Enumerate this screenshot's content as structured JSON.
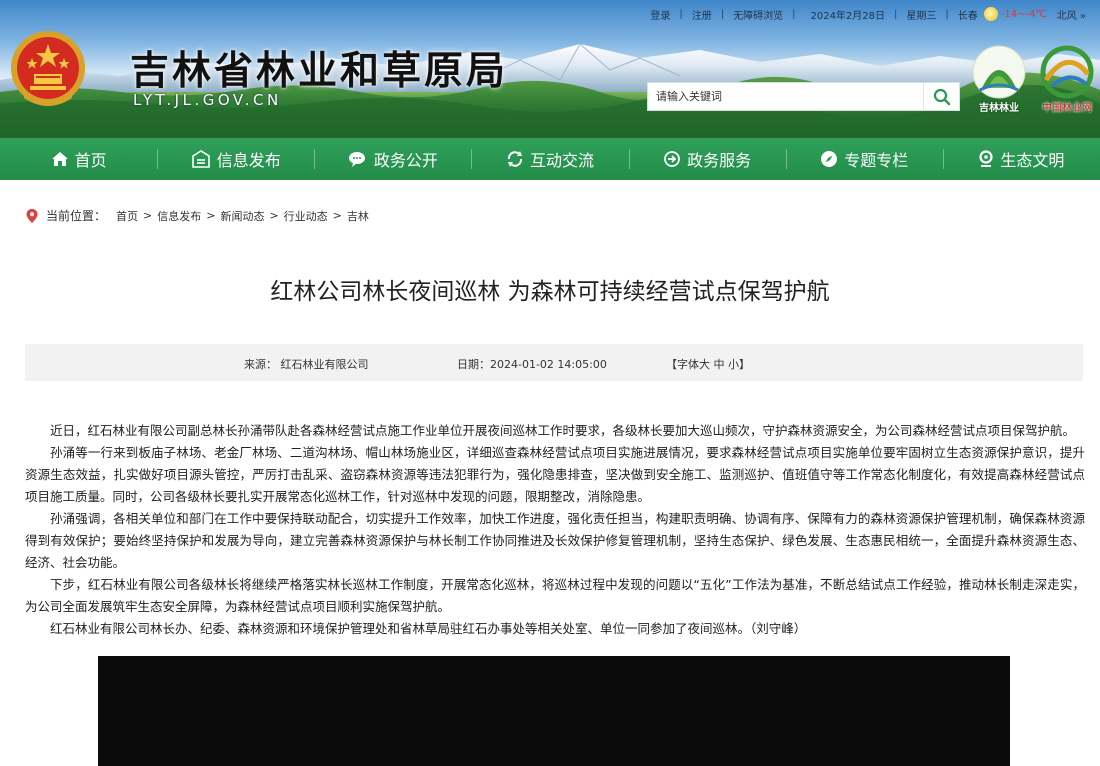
{
  "topbar": {
    "login": "登录",
    "register": "注册",
    "accessible": "无障碍浏览",
    "date": "2024年2月28日",
    "weekday": "星期三",
    "city": "长春",
    "temperature": "-14~-4℃",
    "wind": "北风 »"
  },
  "header": {
    "title": "吉林省林业和草原局",
    "url": "LYT.JL.GOV.CN",
    "search_placeholder": "请输入关键词",
    "logo_jilin": "吉林林业",
    "logo_cn": "中国林业网",
    "search_icon": "search-icon"
  },
  "nav": [
    {
      "label": "首页",
      "icon": "home-icon"
    },
    {
      "label": "信息发布",
      "icon": "info-icon"
    },
    {
      "label": "政务公开",
      "icon": "chat-icon"
    },
    {
      "label": "互动交流",
      "icon": "refresh-icon"
    },
    {
      "label": "政务服务",
      "icon": "service-icon"
    },
    {
      "label": "专题专栏",
      "icon": "compass-icon"
    },
    {
      "label": "生态文明",
      "icon": "pin-icon"
    }
  ],
  "breadcrumb": {
    "label": "当前位置：",
    "items": [
      "首页",
      "信息发布",
      "新闻动态",
      "行业动态",
      "吉林"
    ],
    "separator": ">"
  },
  "article": {
    "title": "红林公司林长夜间巡林 为森林可持续经营试点保驾护航",
    "source": "来源：  红石林业有限公司",
    "date": "日期：2024-01-02 14:05:00",
    "font_prefix": "【字体",
    "font_big": "大",
    "font_mid": "中",
    "font_small": "小",
    "font_suffix": "】",
    "paragraphs": [
      "近日，红石林业有限公司副总林长孙涌带队赴各森林经营试点施工作业单位开展夜间巡林工作时要求，各级林长要加大巡山频次，守护森林资源安全，为公司森林经营试点项目保驾护航。",
      "孙涌等一行来到板庙子林场、老金厂林场、二道沟林场、帽山林场施业区，详细巡查森林经营试点项目实施进展情况，要求森林经营试点项目实施单位要牢固树立生态资源保护意识，提升资源生态效益，扎实做好项目源头管控，严厉打击乱采、盗窃森林资源等违法犯罪行为，强化隐患排查，坚决做到安全施工、监测巡护、值班值守等工作常态化制度化，有效提高森林经营试点项目施工质量。同时，公司各级林长要扎实开展常态化巡林工作，针对巡林中发现的问题，限期整改，消除隐患。",
      "孙涌强调，各相关单位和部门在工作中要保持联动配合，切实提升工作效率，加快工作进度，强化责任担当，构建职责明确、协调有序、保障有力的森林资源保护管理机制，确保森林资源得到有效保护；要始终坚持保护和发展为导向，建立完善森林资源保护与林长制工作协同推进及长效保护修复管理机制，坚持生态保护、绿色发展、生态惠民相统一，全面提升森林资源生态、经济、社会功能。",
      "下步，红石林业有限公司各级林长将继续严格落实林长巡林工作制度，开展常态化巡林，将巡林过程中发现的问题以“五化”工作法为基准，不断总结试点工作经验，推动林长制走深走实，为公司全面发展筑牢生态安全屏障，为森林经营试点项目顺利实施保驾护航。",
      "红石林业有限公司林长办、纪委、森林资源和环境保护管理处和省林草局驻红石办事处等相关处室、单位一同参加了夜间巡林。（刘守峰）"
    ]
  },
  "colors": {
    "nav_green": "#2a9852",
    "temperature_red": "#e43535",
    "meta_bg": "#f2f2f2",
    "breadcrumb_pin": "#e04040"
  }
}
